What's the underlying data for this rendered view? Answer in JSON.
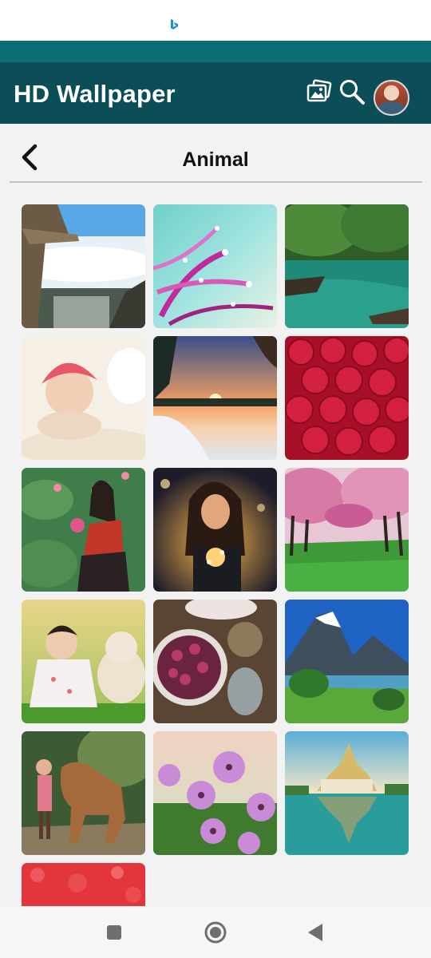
{
  "app": {
    "title": "HD Wallpaper"
  },
  "page": {
    "title": "Animal"
  },
  "icons": {
    "gallery": "gallery-icon",
    "search": "search-icon",
    "avatar": "avatar",
    "back": "back-arrow-icon",
    "bing": "bing-icon"
  },
  "colors": {
    "app_bar": "#0b4e58",
    "status_strip": "#0b6e72",
    "background": "#f2f2f2"
  },
  "wallpapers": [
    {
      "subject": "cliff above clouds"
    },
    {
      "subject": "pink flower with water drops"
    },
    {
      "subject": "forest river"
    },
    {
      "subject": "baby with pink headscarf"
    },
    {
      "subject": "winter sunset"
    },
    {
      "subject": "red roses"
    },
    {
      "subject": "woman with lotus flowers"
    },
    {
      "subject": "woman holding lights"
    },
    {
      "subject": "cherry blossom park"
    },
    {
      "subject": "baby with teddy bear"
    },
    {
      "subject": "berries bowl"
    },
    {
      "subject": "mountain lake"
    },
    {
      "subject": "girl with horse"
    },
    {
      "subject": "purple daisies"
    },
    {
      "subject": "temple reflection"
    },
    {
      "subject": "red bokeh"
    }
  ],
  "nav": {
    "recent": "square-icon",
    "home": "circle-icon",
    "back": "triangle-back-icon"
  }
}
